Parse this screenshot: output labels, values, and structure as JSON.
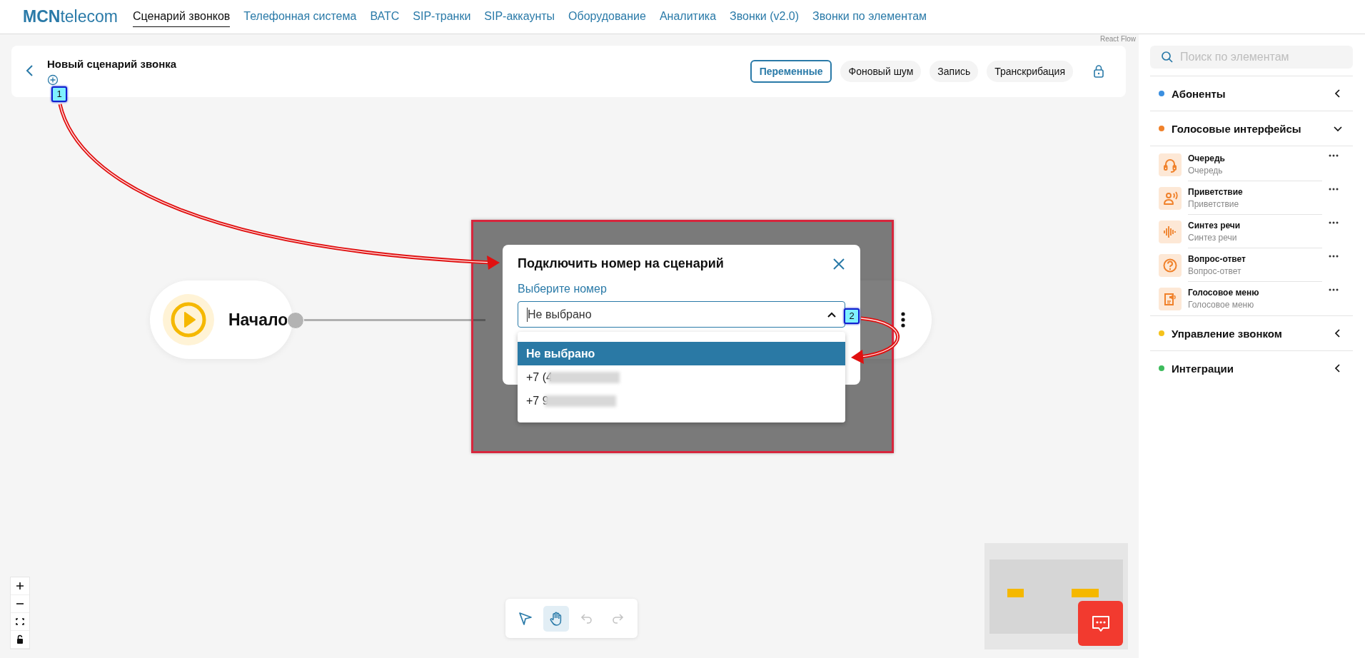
{
  "nav": {
    "logo": "**MCN**telecom",
    "items": [
      {
        "label": "Сценарий звонков",
        "selected": true
      },
      {
        "label": "Телефонная система",
        "selected": false
      },
      {
        "label": "ВАТС",
        "selected": false
      },
      {
        "label": "SIP-транки",
        "selected": false
      },
      {
        "label": "SIP-аккаунты",
        "selected": false
      },
      {
        "label": "Оборудование",
        "selected": false
      },
      {
        "label": "Аналитика",
        "selected": false
      },
      {
        "label": "Звонки (v2.0)",
        "selected": false
      },
      {
        "label": "Звонки по элементам",
        "selected": false
      }
    ]
  },
  "header": {
    "title": "Новый сценарий звонка",
    "buttons": [
      {
        "label": "Переменные",
        "selected": true
      },
      {
        "label": "Фоновый шум",
        "selected": false
      },
      {
        "label": "Запись",
        "selected": false
      },
      {
        "label": "Транскрибация",
        "selected": false
      }
    ]
  },
  "attribution": "React Flow",
  "nodes": [
    {
      "kind": "start",
      "label": "Начало"
    },
    {
      "kind": "step"
    }
  ],
  "modal": {
    "title": "Подключить номер на сценарий",
    "field_label": "Выберите номер",
    "select": {
      "value": "Не выбрано",
      "expanded": true
    },
    "options": [
      {
        "label": "Не выбрано",
        "selected": true,
        "redacted": false
      },
      {
        "label": "+7 (4",
        "selected": false,
        "redacted": true
      },
      {
        "label": "+7 9",
        "selected": false,
        "redacted": true
      }
    ]
  },
  "sidebar": {
    "search": {
      "placeholder": "Поиск по элементам"
    },
    "categories": [
      {
        "label": "Абоненты",
        "color": "#3b8fe0",
        "expanded": false
      },
      {
        "label": "Голосовые интерфейсы",
        "color": "#f0812a",
        "expanded": true,
        "items": [
          {
            "title": "Очередь",
            "subtitle": "Очередь"
          },
          {
            "title": "Приветствие",
            "subtitle": "Приветствие"
          },
          {
            "title": "Синтез речи",
            "subtitle": "Синтез речи"
          },
          {
            "title": "Вопрос-ответ",
            "subtitle": "Вопрос-ответ"
          },
          {
            "title": "Голосовое меню",
            "subtitle": "Голосовое меню"
          }
        ]
      },
      {
        "label": "Управление звонком",
        "color": "#f5c21b",
        "expanded": false
      },
      {
        "label": "Интеграции",
        "color": "#3dbb5c",
        "expanded": false
      }
    ]
  },
  "toolbar": [
    {
      "kind": "select",
      "selected": false,
      "disabled": false
    },
    {
      "kind": "pan",
      "selected": true,
      "disabled": false
    },
    {
      "kind": "undo",
      "selected": false,
      "disabled": true
    },
    {
      "kind": "redo",
      "selected": false,
      "disabled": true
    }
  ],
  "annotations": [
    {
      "label": "1"
    },
    {
      "label": "2"
    }
  ]
}
